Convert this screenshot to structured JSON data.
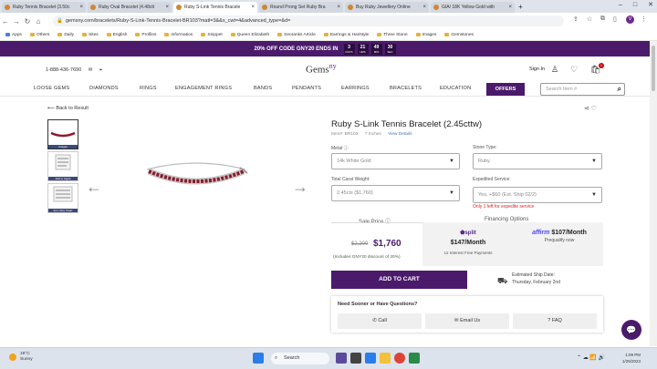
{
  "browser": {
    "tabs": [
      {
        "label": "Ruby Tennis Bracelet (3.50c",
        "active": false
      },
      {
        "label": "Ruby Oval Bracelet (4.48ctt",
        "active": false
      },
      {
        "label": "Ruby S-Link Tennis Bracele",
        "active": true
      },
      {
        "label": "Round Prong Set Ruby Bra",
        "active": false
      },
      {
        "label": "Buy Ruby Jewellery Online",
        "active": false
      },
      {
        "label": "GIA/ 18K Yellow Gold with",
        "active": false
      }
    ],
    "url": "gemsny.com/bracelets/Ruby-S-Link-Tennis-Bracelet-BR103?matl=3&&s_cwt=4&advanced_type=&d=",
    "bookmarks": [
      "Apps",
      "Others",
      "Daily",
      "Sites",
      "English",
      "Profiles",
      "Information",
      "Snippet",
      "Queen Elizabeth",
      "Seoranks Article",
      "Earrings & Hairstyle",
      "Three Stone",
      "Images",
      "Gemstones"
    ],
    "profile_initial": "V"
  },
  "promo": {
    "text": "20% OFF CODE GNY20 ENDS IN",
    "countdown": [
      {
        "value": "3",
        "unit": "DAYS"
      },
      {
        "value": "21",
        "unit": "HRS"
      },
      {
        "value": "49",
        "unit": "MIN"
      },
      {
        "value": "30",
        "unit": "SEC"
      }
    ]
  },
  "header": {
    "phone": "1-888-436-7690",
    "logo": "Gems",
    "logo_suffix": "ny",
    "signin": "Sign In",
    "cart_count": "1"
  },
  "menu": {
    "items": [
      "LOOSE GEMS",
      "DIAMONDS",
      "RINGS",
      "ENGAGEMENT RINGS",
      "BANDS",
      "PENDANTS",
      "EARRINGS",
      "BRACELETS",
      "EDUCATION"
    ],
    "offers": "OFFERS",
    "search_placeholder": "Search Item #"
  },
  "product": {
    "back": "Back to Result",
    "thumb_captions": [
      "Images",
      "Add to Apple",
      "Item Size Chart"
    ],
    "title": "Ruby S-Link Tennis Bracelet (2.45cttw)",
    "item_no": "Item#: BR103",
    "length": "7 Inches",
    "details_link": "View Details",
    "metal_label": "Metal",
    "metal_value": "14k White Gold",
    "stone_label": "Stone Type:",
    "stone_value": "Ruby",
    "weight_label": "Total Carat Weight:",
    "weight_value": "2.45cts ($1,760)",
    "service_label": "Expedited Service:",
    "service_value": "Yes, +$60 (Est. Ship 02/2)",
    "service_warning": "Only 1 left for expedite service",
    "sale_label": "Sale Price",
    "old_price": "$2,200",
    "new_price": "$1,760",
    "discount_note": "(Includes GNY20 discount of 20%)",
    "financing_label": "Financing Options",
    "split_brand": "split",
    "split_amount": "$147/Month",
    "split_note": "12 Interest Free Payments",
    "affirm_brand": "affirm",
    "affirm_amount": "$107/Month",
    "affirm_note": "Prequalify now",
    "add_to_cart": "ADD TO CART",
    "ship_label": "Estimated Ship Date:",
    "ship_date": "Thursday, February 2nd",
    "help_title": "Need Sooner or Have Questions?",
    "help_buttons": [
      "Call",
      "Email Us",
      "FAQ"
    ]
  },
  "taskbar": {
    "temp": "19°C",
    "weather": "Sunny",
    "search": "Search",
    "time": "1:09 PM",
    "date": "1/25/2023"
  },
  "colors": {
    "brand_purple": "#4b1a6b",
    "ruby": "#8b1a2b",
    "warning": "#e02020"
  }
}
